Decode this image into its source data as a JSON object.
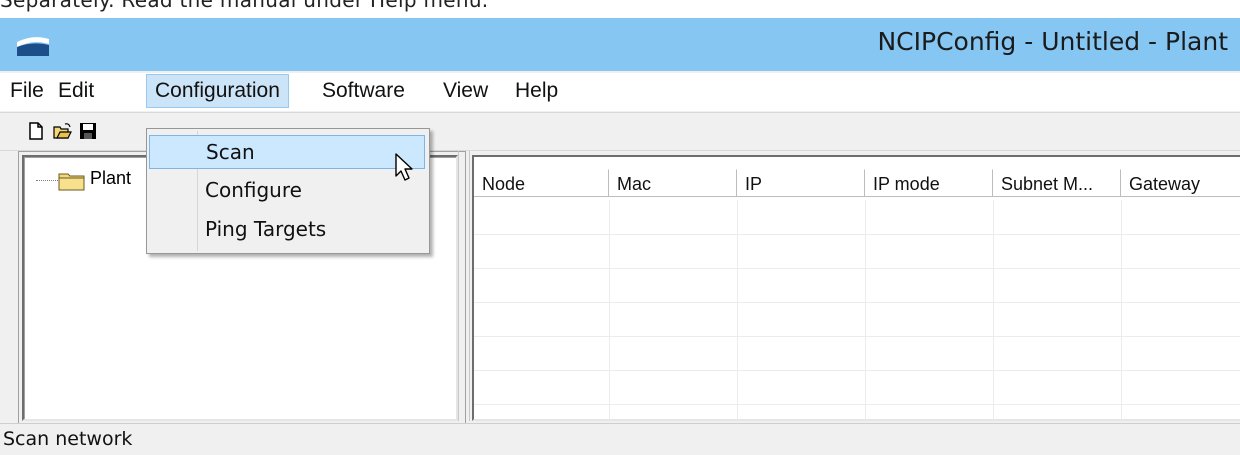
{
  "doc_fragment": "Separately. Read the manual under Help menu.",
  "window": {
    "title": "NCIPConfig - Untitled - Plant",
    "icon": "app-logo-icon"
  },
  "menubar": {
    "items": [
      {
        "label": "File"
      },
      {
        "label": "Edit"
      },
      {
        "label": "Configuration",
        "active": true
      },
      {
        "label": "Software"
      },
      {
        "label": "View"
      },
      {
        "label": "Help"
      }
    ]
  },
  "toolbar": {
    "buttons": [
      "new-file-icon",
      "open-folder-icon",
      "save-icon"
    ]
  },
  "configuration_menu": {
    "items": [
      {
        "label": "Scan",
        "highlighted": true
      },
      {
        "label": "Configure"
      },
      {
        "label": "Ping Targets"
      }
    ]
  },
  "tree": {
    "root_label": "Plant",
    "root_icon": "folder-icon"
  },
  "grid": {
    "columns": [
      "Node",
      "Mac",
      "IP",
      "IP mode",
      "Subnet M...",
      "Gateway"
    ],
    "rows": []
  },
  "statusbar": {
    "text": "Scan network"
  },
  "colors": {
    "titlebar": "#86c6f2",
    "menu_highlight": "#cce8ff",
    "folder": "#f3d77a"
  }
}
